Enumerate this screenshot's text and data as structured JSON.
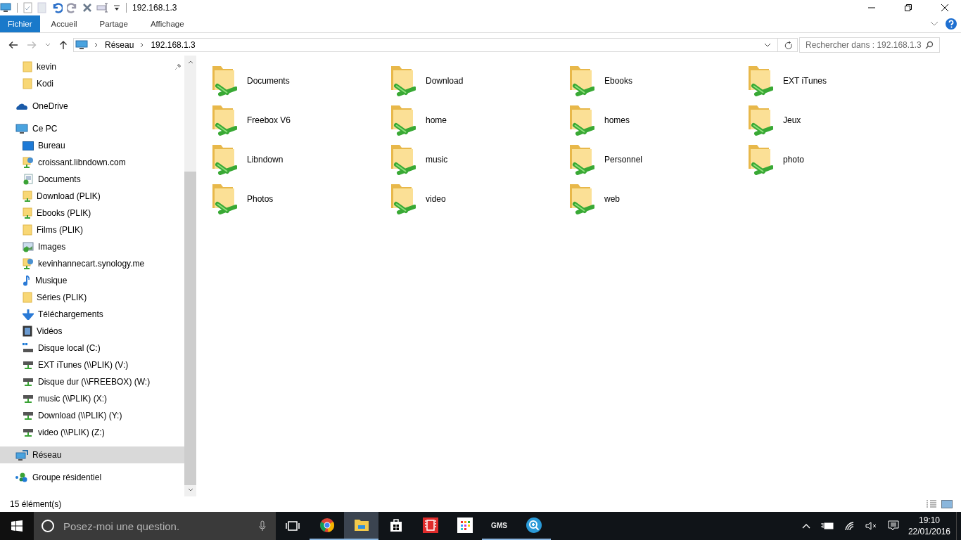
{
  "window": {
    "title": "192.168.1.3"
  },
  "ribbon": {
    "tabs": [
      {
        "label": "Fichier",
        "selected": true
      },
      {
        "label": "Accueil",
        "selected": false
      },
      {
        "label": "Partage",
        "selected": false
      },
      {
        "label": "Affichage",
        "selected": false
      }
    ]
  },
  "address": {
    "path": [
      "Réseau",
      "192.168.1.3"
    ]
  },
  "search": {
    "placeholder": "Rechercher dans : 192.168.1.3"
  },
  "sidebar": {
    "quick_access_items": [
      {
        "label": "kevin",
        "kind": "folder",
        "selected": false
      },
      {
        "label": "Kodi",
        "kind": "folder",
        "selected": false
      }
    ],
    "items": [
      {
        "label": "OneDrive",
        "kind": "cloud",
        "selected": false
      },
      {
        "label": "Ce PC",
        "kind": "pc",
        "selected": false,
        "children": [
          {
            "label": "Bureau",
            "kind": "desktop",
            "selected": false
          },
          {
            "label": "croissant.libndown.com",
            "kind": "globe",
            "selected": false
          },
          {
            "label": "Documents",
            "kind": "documents",
            "selected": false
          },
          {
            "label": "Download (PLIK)",
            "kind": "netfolder",
            "selected": false
          },
          {
            "label": "Ebooks (PLIK)",
            "kind": "netfolder",
            "selected": false
          },
          {
            "label": "Films (PLIK)",
            "kind": "folder",
            "selected": false
          },
          {
            "label": "Images",
            "kind": "images",
            "selected": false
          },
          {
            "label": "kevinhannecart.synology.me",
            "kind": "globe",
            "selected": false
          },
          {
            "label": "Musique",
            "kind": "music",
            "selected": false
          },
          {
            "label": "Séries (PLIK)",
            "kind": "folder",
            "selected": false
          },
          {
            "label": "Téléchargements",
            "kind": "download",
            "selected": false
          },
          {
            "label": "Vidéos",
            "kind": "video",
            "selected": false
          },
          {
            "label": "Disque local (C:)",
            "kind": "disk",
            "selected": false
          },
          {
            "label": "EXT iTunes (\\\\PLIK) (V:)",
            "kind": "netdrive",
            "selected": false
          },
          {
            "label": "Disque dur (\\\\FREEBOX) (W:)",
            "kind": "netdrive",
            "selected": false
          },
          {
            "label": "music (\\\\PLIK) (X:)",
            "kind": "netdrive",
            "selected": false
          },
          {
            "label": "Download (\\\\PLIK) (Y:)",
            "kind": "netdrive",
            "selected": false
          },
          {
            "label": "video (\\\\PLIK) (Z:)",
            "kind": "netdrive",
            "selected": false
          }
        ]
      },
      {
        "label": "Réseau",
        "kind": "network",
        "selected": true
      },
      {
        "label": "Groupe résidentiel",
        "kind": "homegroup",
        "selected": false
      }
    ]
  },
  "folders": [
    {
      "name": "Documents"
    },
    {
      "name": "Download"
    },
    {
      "name": "Ebooks"
    },
    {
      "name": "EXT iTunes"
    },
    {
      "name": "Freebox V6"
    },
    {
      "name": "home"
    },
    {
      "name": "homes"
    },
    {
      "name": "Jeux"
    },
    {
      "name": "Libndown"
    },
    {
      "name": "music"
    },
    {
      "name": "Personnel"
    },
    {
      "name": "photo"
    },
    {
      "name": "Photos"
    },
    {
      "name": "video"
    },
    {
      "name": "web"
    }
  ],
  "status_bar": {
    "count": "15 élément(s)"
  },
  "taskbar": {
    "search": {
      "placeholder": "Posez-moi une question."
    },
    "apps": [
      {
        "kind": "chrome",
        "running": true,
        "active": false
      },
      {
        "kind": "explorer",
        "running": true,
        "active": true
      },
      {
        "kind": "store",
        "running": false,
        "active": false
      },
      {
        "kind": "film",
        "running": false,
        "active": false
      },
      {
        "kind": "tiles",
        "running": false,
        "active": false
      },
      {
        "kind": "gms",
        "label": "GMS",
        "running": true,
        "active": false
      },
      {
        "kind": "magnifier",
        "running": true,
        "active": false
      }
    ],
    "time": "19:10",
    "date": "22/01/2016"
  }
}
